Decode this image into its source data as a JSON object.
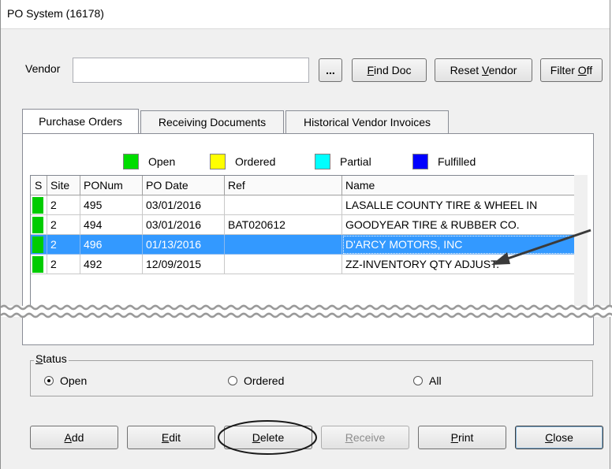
{
  "window": {
    "title": "PO System (16178)"
  },
  "vendor": {
    "label": "Vendor",
    "value": ""
  },
  "toolbar": {
    "ellipsis_label": "...",
    "find_doc": {
      "pre": "",
      "u": "F",
      "post": "ind Doc"
    },
    "reset_vendor": {
      "pre": "Reset ",
      "u": "V",
      "post": "endor"
    },
    "filter_off": {
      "pre": "Filter ",
      "u": "O",
      "post": "ff"
    }
  },
  "tabs": [
    {
      "label": "Purchase Orders"
    },
    {
      "label": "Receiving Documents"
    },
    {
      "label": "Historical Vendor Invoices"
    }
  ],
  "legend": [
    {
      "label": "Open",
      "color": "#00dd00"
    },
    {
      "label": "Ordered",
      "color": "#ffff00"
    },
    {
      "label": "Partial",
      "color": "#00ffff"
    },
    {
      "label": "Fulfilled",
      "color": "#0000ff"
    }
  ],
  "grid": {
    "headers": [
      "S",
      "Site",
      "PONum",
      "PO Date",
      "Ref",
      "Name"
    ],
    "rows": [
      {
        "site": "2",
        "ponum": "495",
        "date": "03/01/2016",
        "ref": "",
        "name": "LASALLE COUNTY TIRE & WHEEL IN"
      },
      {
        "site": "2",
        "ponum": "494",
        "date": "03/01/2016",
        "ref": "BAT020612",
        "name": "GOODYEAR TIRE & RUBBER CO."
      },
      {
        "site": "2",
        "ponum": "496",
        "date": "01/13/2016",
        "ref": "",
        "name": "D'ARCY MOTORS, INC"
      },
      {
        "site": "2",
        "ponum": "492",
        "date": "12/09/2015",
        "ref": "",
        "name": "ZZ-INVENTORY QTY ADJUST."
      }
    ]
  },
  "status_group": {
    "legend": {
      "u": "S",
      "post": "tatus"
    },
    "options": [
      {
        "label": "Open",
        "checked": true
      },
      {
        "label": "Ordered",
        "checked": false
      },
      {
        "label": "All",
        "checked": false
      }
    ]
  },
  "buttons": {
    "add": {
      "u": "A",
      "post": "dd"
    },
    "edit": {
      "u": "E",
      "post": "dit"
    },
    "delete": {
      "u": "D",
      "post": "elete"
    },
    "receive": {
      "u": "R",
      "post": "eceive"
    },
    "print": {
      "u": "P",
      "post": "rint"
    },
    "close": {
      "u": "C",
      "post": "lose"
    }
  }
}
